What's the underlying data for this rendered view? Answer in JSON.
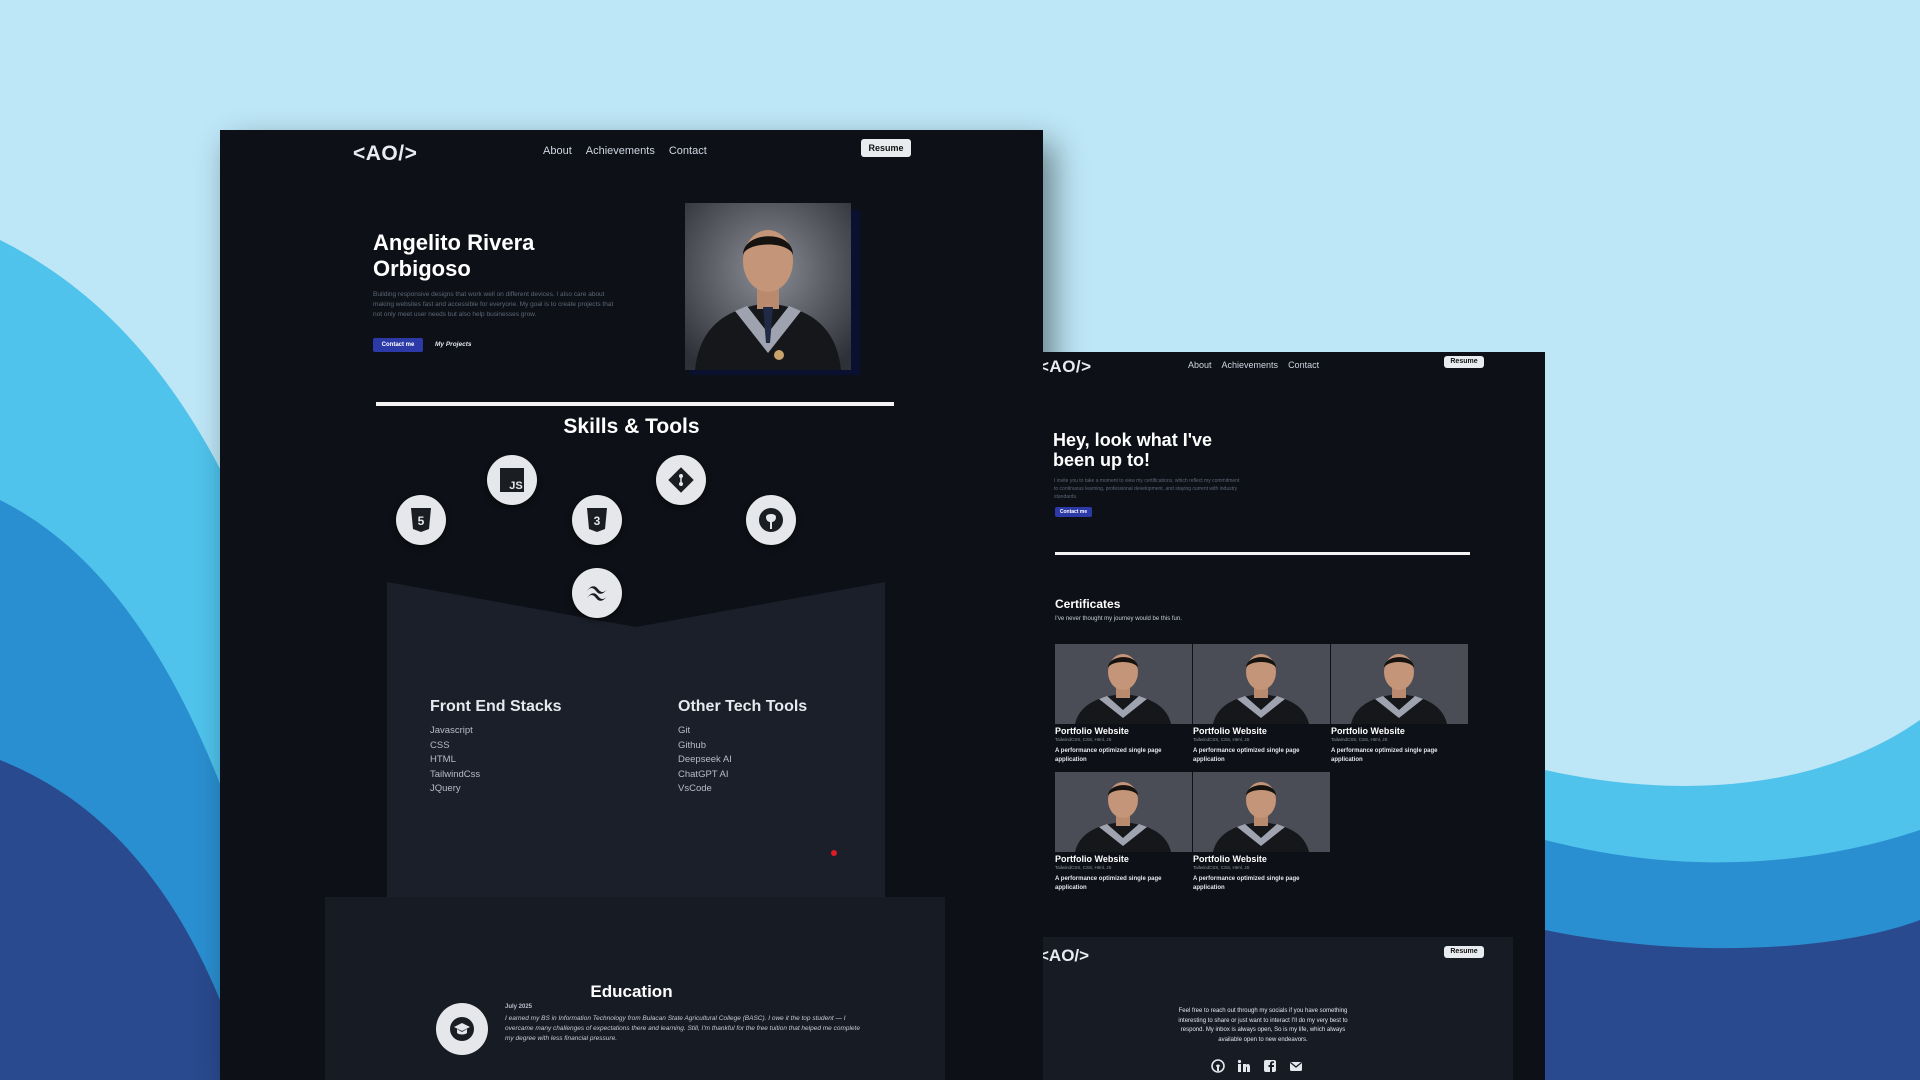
{
  "colors": {
    "background_light": "#bde6f6",
    "wave_light": "#4fc3ec",
    "wave_mid": "#2a8fd0",
    "wave_dark": "#2a4a8f",
    "screen_bg": "#0d1016",
    "panel_bg": "#1a1f29",
    "accent_button": "#2c3aa8",
    "red_dot": "#e01b24"
  },
  "left_page": {
    "nav": {
      "logo": "<AO/>",
      "links": [
        "About",
        "Achievements",
        "Contact"
      ],
      "resume_label": "Resume"
    },
    "hero": {
      "name": "Angelito Rivera Orbigoso",
      "bio": "Building responsive designs that work well on different devices. I also care about making websites fast and accessible for everyone. My goal is to create projects that not only meet user needs but also help businesses grow.",
      "contact_label": "Contact me",
      "projects_label": "My Projects",
      "portrait_icon": "graduation-portrait"
    },
    "skills": {
      "title": "Skills & Tools",
      "icons": [
        "html5-icon",
        "javascript-icon",
        "css3-icon",
        "git-icon",
        "github-icon",
        "tailwind-icon"
      ]
    },
    "stacks": {
      "front_end_title": "Front End Stacks",
      "front_end_items": [
        "Javascript",
        "CSS",
        "HTML",
        "TailwindCss",
        "JQuery"
      ],
      "tools_title": "Other Tech Tools",
      "tools_items": [
        "Git",
        "Github",
        "Deepseek AI",
        "ChatGPT AI",
        "VsCode"
      ]
    },
    "education": {
      "title": "Education",
      "date": "July 2025",
      "text": "I earned my BS in Information Technology from Bulacan State Agricultural College (BASC). I owe it the top student — I overcame many challenges of expectations there and learning. Still, I'm thankful for the free tuition that helped me complete my degree with less financial pressure."
    }
  },
  "right_page": {
    "nav": {
      "logo": "<AO/>",
      "links": [
        "About",
        "Achievements",
        "Contact"
      ],
      "resume_label": "Resume"
    },
    "hero": {
      "title": "Hey, look what I've been up to!",
      "subtitle": "I invite you to take a moment to view my certifications, which reflect my commitment to continuous learning, professional development, and staying current with industry standards.",
      "contact_label": "Contact me"
    },
    "certificates": {
      "title": "Certificates",
      "subtitle": "I've never thought my journey would be this fun.",
      "cards": [
        {
          "name": "Portfolio Website",
          "tech": "TailwindCSS, CSS, Html, JS",
          "desc": "A performance optimized single page application"
        },
        {
          "name": "Portfolio Website",
          "tech": "TailwindCSS, CSS, Html, JS",
          "desc": "A performance optimized single page application"
        },
        {
          "name": "Portfolio Website",
          "tech": "TailwindCSS, CSS, Html, JS",
          "desc": "A performance optimized single page application"
        },
        {
          "name": "Portfolio Website",
          "tech": "TailwindCSS, CSS, Html, JS",
          "desc": "A performance optimized single page application"
        },
        {
          "name": "Portfolio Website",
          "tech": "TailwindCSS, CSS, Html, JS",
          "desc": "A performance optimized single page application"
        }
      ]
    },
    "footer": {
      "logo": "<AO/>",
      "resume_label": "Resume",
      "text": "Feel free to reach out through my socials if you have something interesting to share or just want to interact I'll do my very best to respond. My inbox is always open, So is my life, which always available open to new endeavors.",
      "socials": [
        "github-icon",
        "linkedin-icon",
        "facebook-icon",
        "mail-icon"
      ]
    }
  }
}
